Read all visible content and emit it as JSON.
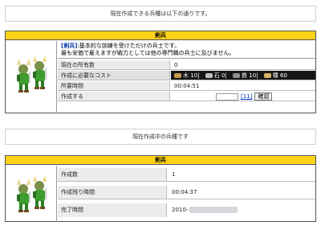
{
  "top_notice": "現在作成できる兵種は以下の通りです。",
  "unit": {
    "title": "剣兵",
    "desc_name": "[剣兵]",
    "desc_line1": ":基本的な訓練を受けただけの兵士です。",
    "desc_line2": "最も安価で雇えますが戦力としては他の専門職の兵士に及びません。",
    "rows": {
      "owned_label": "現在の所有数",
      "owned_value": "0",
      "cost_label": "作成に必要なコスト",
      "time_label": "所要時間",
      "time_value": "00:04:51",
      "create_label": "作成する"
    },
    "costs": [
      {
        "name": "木",
        "value": "10",
        "sep": "|",
        "icon": "wood-icon"
      },
      {
        "name": "石",
        "value": "0",
        "sep": "|",
        "icon": "stone-icon"
      },
      {
        "name": "鉄",
        "value": "10",
        "sep": "|",
        "icon": "iron-icon"
      },
      {
        "name": "糧",
        "value": "60",
        "sep": "",
        "icon": "food-icon"
      }
    ],
    "max_link": "[11]",
    "confirm_button": "確認"
  },
  "mid_notice": "現在作成中の兵種です",
  "queue": {
    "title": "剣兵",
    "count_label": "作成数",
    "count_value": "1",
    "remaining_label": "作成残り時間",
    "remaining_value": "00:04:37",
    "done_label": "完了時間",
    "done_value": "2010-"
  },
  "colors": {
    "header_yellow": "#ffd21a",
    "link_blue": "#0033cc",
    "cost_bar": "#161616"
  }
}
